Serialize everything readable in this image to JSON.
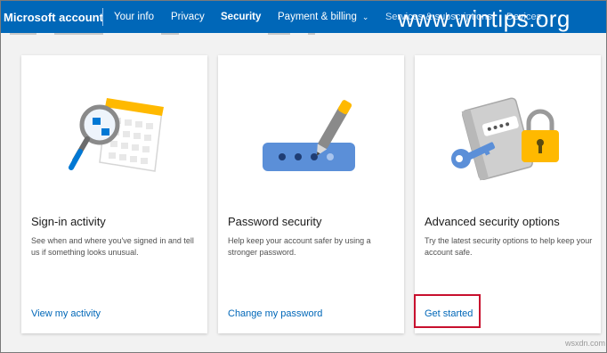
{
  "header": {
    "brand": "Microsoft account",
    "nav": [
      {
        "label": "Your info"
      },
      {
        "label": "Privacy"
      },
      {
        "label": "Security"
      },
      {
        "label": "Payment & billing"
      }
    ],
    "partial_items": [
      "Services & subscriptions",
      "Devices"
    ],
    "watermark": "www.wintips.org",
    "colors": {
      "bar": "#0067b8",
      "link": "#0067b8",
      "highlight": "#c8102e"
    }
  },
  "cards": [
    {
      "title": "Sign-in activity",
      "description": "See when and where you've signed in and tell us if something looks unusual.",
      "link": "View my activity",
      "icon": "calendar-magnifier-icon"
    },
    {
      "title": "Password security",
      "description": "Help keep your account safer by using a stronger password.",
      "link": "Change my password",
      "icon": "password-pen-icon"
    },
    {
      "title": "Advanced security options",
      "description": "Try the latest security options to help keep your account safe.",
      "link": "Get started",
      "icon": "key-lock-icon"
    }
  ],
  "footer_watermark": "wsxdn.com"
}
